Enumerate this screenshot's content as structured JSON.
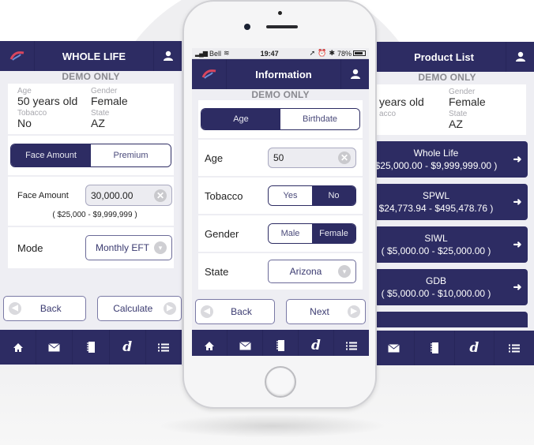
{
  "colors": {
    "navy": "#2d2c63",
    "background": "#eeeef3",
    "muted": "#a8a8ae"
  },
  "demo_label": "DEMO ONLY",
  "left_screen": {
    "title": "WHOLE LIFE",
    "summary": {
      "age_label": "Age",
      "age_value": "50 years old",
      "gender_label": "Gender",
      "gender_value": "Female",
      "tobacco_label": "Tobacco",
      "tobacco_value": "No",
      "state_label": "State",
      "state_value": "AZ"
    },
    "segment": {
      "options": [
        "Face Amount",
        "Premium"
      ],
      "selected": "Face Amount"
    },
    "face_amount": {
      "label": "Face Amount",
      "value": "30,000.00",
      "range": "( $25,000 - $9,999,999 )"
    },
    "mode": {
      "label": "Mode",
      "value": "Monthly EFT"
    },
    "back_label": "Back",
    "calculate_label": "Calculate"
  },
  "phone": {
    "status": {
      "carrier": "Bell",
      "time": "19:47",
      "battery": "78%"
    },
    "title": "Information",
    "segment": {
      "options": [
        "Age",
        "Birthdate"
      ],
      "selected": "Age"
    },
    "age": {
      "label": "Age",
      "value": "50"
    },
    "tobacco": {
      "label": "Tobacco",
      "options": [
        "Yes",
        "No"
      ],
      "selected": "No"
    },
    "gender": {
      "label": "Gender",
      "options": [
        "Male",
        "Female"
      ],
      "selected": "Female"
    },
    "state": {
      "label": "State",
      "value": "Arizona"
    },
    "back_label": "Back",
    "next_label": "Next"
  },
  "right_screen": {
    "title": "Product List",
    "summary": {
      "age_value": "years old",
      "gender_label": "Gender",
      "gender_value": "Female",
      "tobacco_label": "acco",
      "state_label": "State",
      "state_value": "AZ"
    },
    "products": [
      {
        "name": "Whole Life",
        "range": "$25,000.00 - $9,999,999.00 )"
      },
      {
        "name": "SPWL",
        "range": "$24,773.94 - $495,478.76 )"
      },
      {
        "name": "SIWL",
        "range": "( $5,000.00 - $25,000.00 )"
      },
      {
        "name": "GDB",
        "range": "( $5,000.00 - $10,000.00 )"
      }
    ]
  },
  "tabbar": {
    "icons": [
      "home-icon",
      "mail-icon",
      "notebook-icon",
      "d-logo-icon",
      "list-icon"
    ],
    "d_glyph": "d",
    "home_glyph": "⌂",
    "mail_glyph": "✉",
    "notebook_glyph": "▮",
    "list_glyph": "☰"
  },
  "icons": {
    "arrow_right": "➜",
    "clear": "✕",
    "chevron": "▾",
    "left": "◀",
    "right": "▶",
    "user": "👤"
  }
}
